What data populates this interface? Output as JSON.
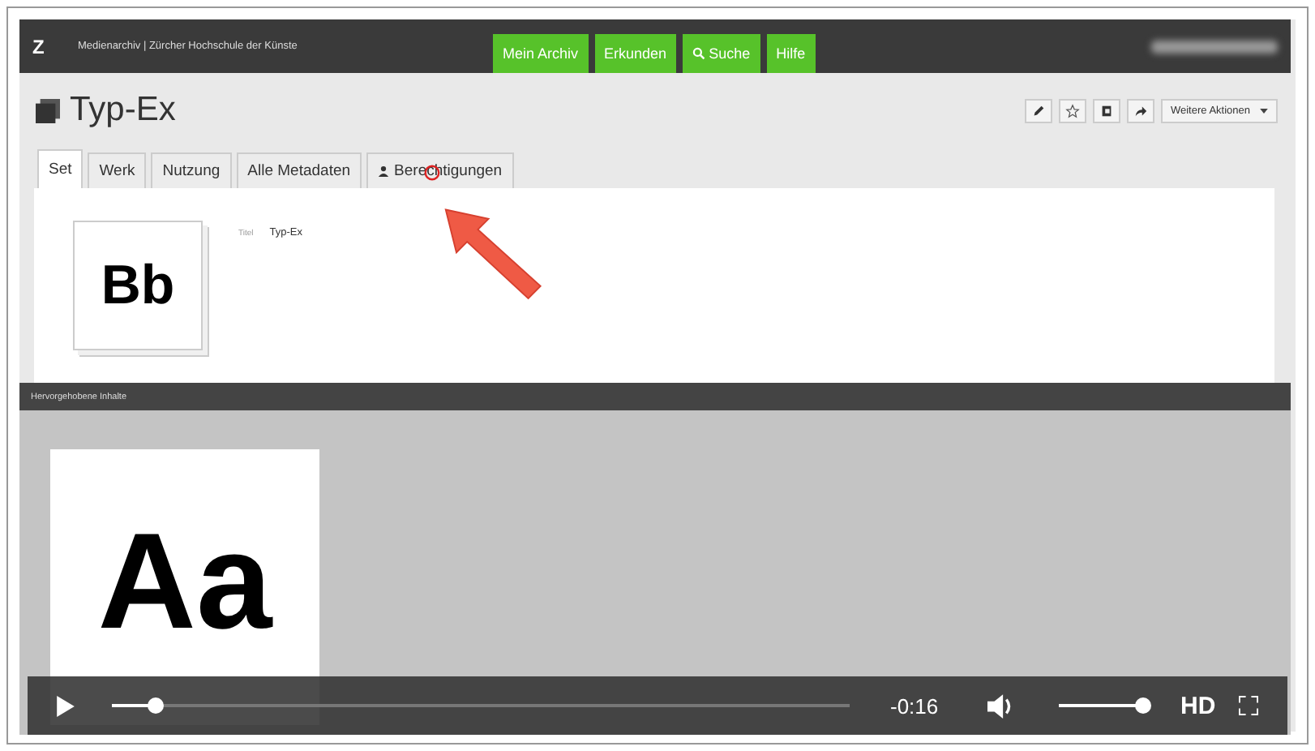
{
  "header": {
    "logo": "Z",
    "site": "Medienarchiv | Zürcher Hochschule der Künste",
    "nav": [
      {
        "label": "Mein Archiv",
        "kind": "text"
      },
      {
        "label": "Erkunden",
        "kind": "text"
      },
      {
        "label": "Suche",
        "kind": "search"
      },
      {
        "label": "Hilfe",
        "kind": "text"
      }
    ]
  },
  "title": "Typ-Ex",
  "toolbar": {
    "icons": [
      {
        "kind": "pencil"
      },
      {
        "kind": "star"
      },
      {
        "kind": "copy"
      },
      {
        "kind": "share"
      }
    ],
    "more": "Weitere Aktionen"
  },
  "tabs": [
    {
      "label": "Set",
      "selected": true,
      "kind": "text"
    },
    {
      "label": "Werk",
      "selected": false,
      "kind": "text"
    },
    {
      "label": "Nutzung",
      "selected": false,
      "kind": "text"
    },
    {
      "label": "Alle Metadaten",
      "selected": false,
      "kind": "text"
    },
    {
      "label": "Berechtigungen",
      "selected": false,
      "kind": "person"
    }
  ],
  "set": {
    "thumbnail": "Bb",
    "meta": [
      {
        "label": "Titel",
        "value": "Typ-Ex"
      }
    ]
  },
  "featured": {
    "title": "Hervorgehobene Inhalte",
    "items": [
      {
        "thumbnail": "Aa"
      }
    ]
  },
  "player": {
    "progress": {
      "level": 0.06
    },
    "time": "-0:16",
    "volume": {
      "level": 1
    },
    "quality": "HD"
  }
}
